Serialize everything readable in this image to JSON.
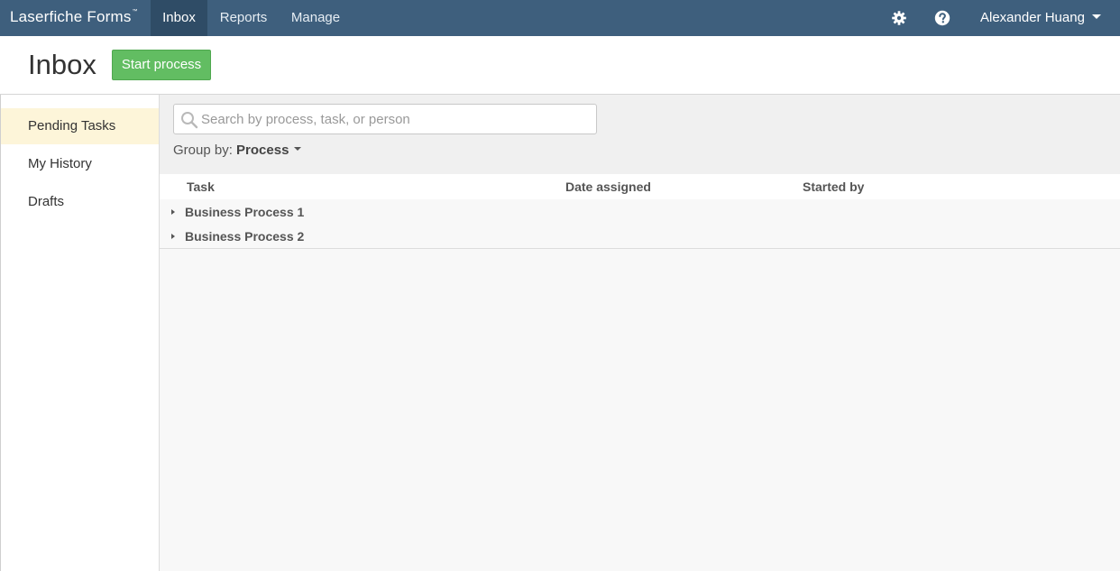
{
  "nav": {
    "brand": "Laserfiche Forms",
    "brand_mark": "™",
    "items": [
      {
        "label": "Inbox",
        "active": true
      },
      {
        "label": "Reports",
        "active": false
      },
      {
        "label": "Manage",
        "active": false
      }
    ],
    "icons": [
      "gear-icon",
      "help-icon"
    ],
    "user": "Alexander Huang"
  },
  "header": {
    "title": "Inbox",
    "start_button": "Start process"
  },
  "sidebar": {
    "items": [
      {
        "label": "Pending Tasks",
        "active": true
      },
      {
        "label": "My History",
        "active": false
      },
      {
        "label": "Drafts",
        "active": false
      }
    ]
  },
  "search": {
    "placeholder": "Search by process, task, or person",
    "value": ""
  },
  "groupby": {
    "label": "Group by:",
    "value": "Process"
  },
  "table": {
    "columns": [
      "Task",
      "Date assigned",
      "Started by"
    ],
    "groups": [
      {
        "label": "Business Process 1",
        "expanded": false
      },
      {
        "label": "Business Process 2",
        "expanded": false
      }
    ]
  },
  "colors": {
    "nav_bg": "#3e5f7d",
    "nav_active": "#2f4c66",
    "start_button": "#62bd62",
    "sidebar_active": "#fdf5d9"
  }
}
